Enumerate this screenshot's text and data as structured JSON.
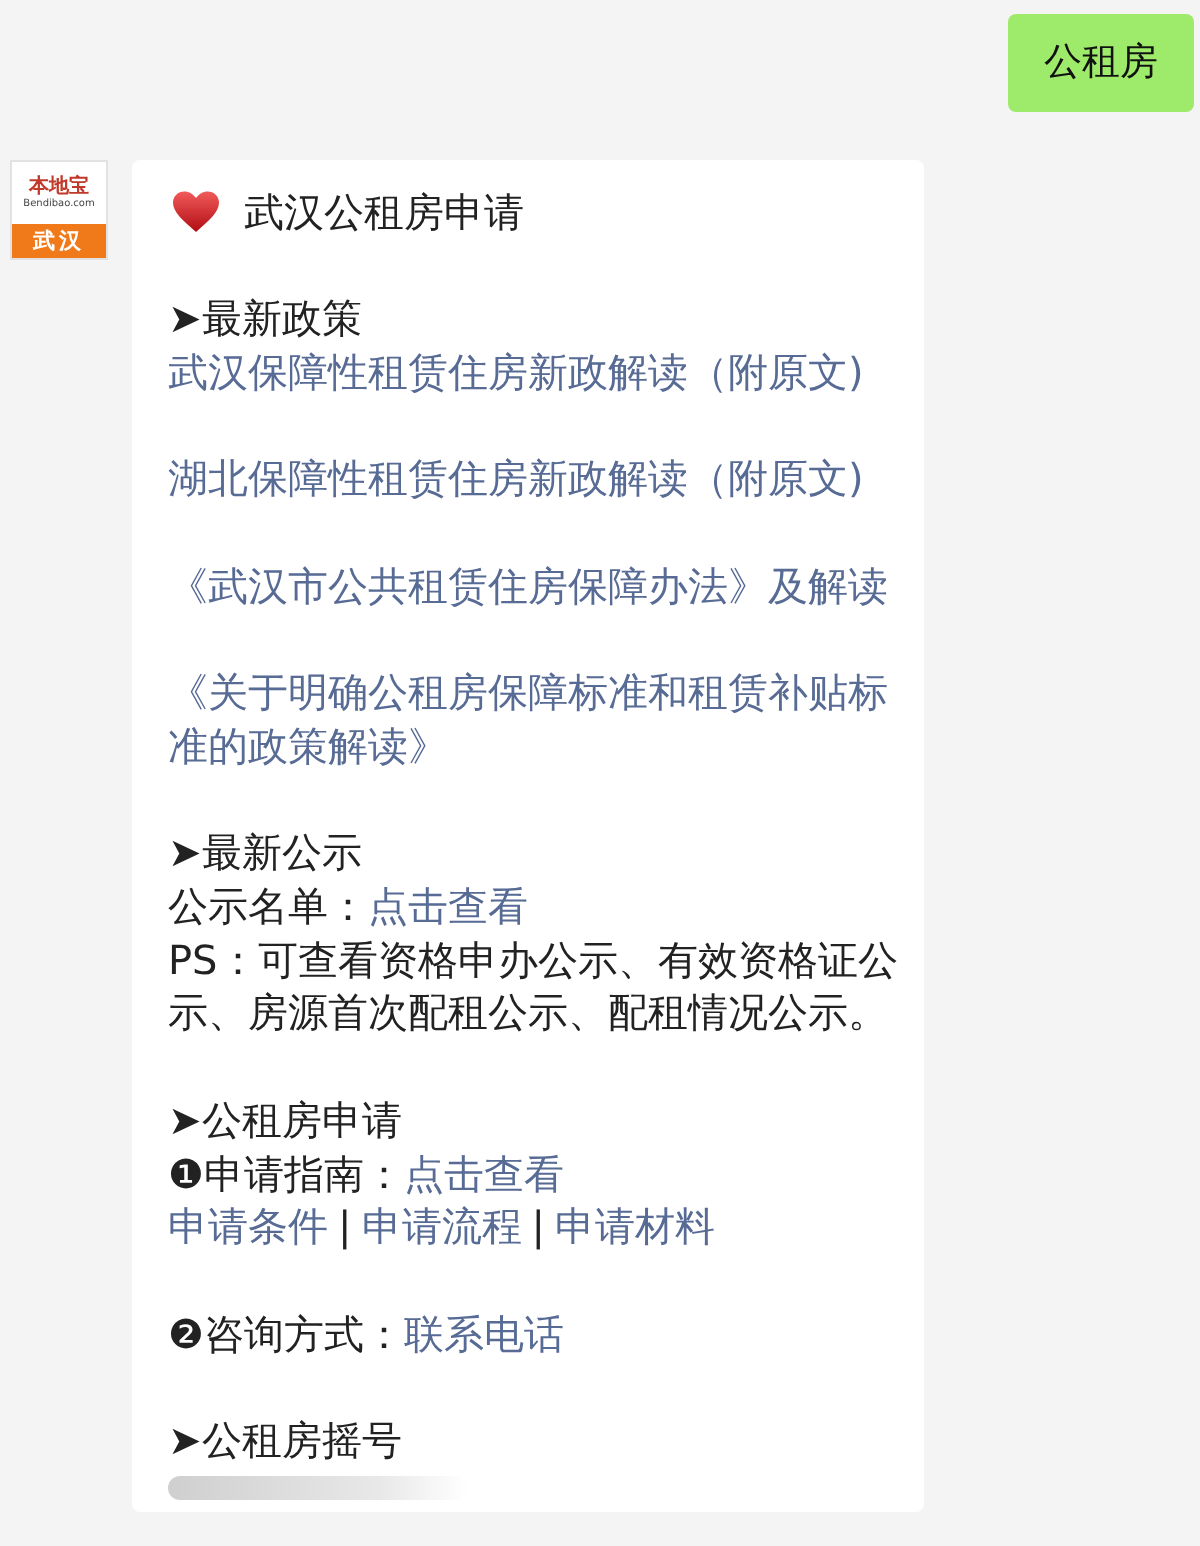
{
  "messages": [
    {
      "kind": "sent",
      "text": "公租房"
    },
    {
      "kind": "received",
      "avatar": {
        "brand": "本地宝",
        "site": "Bendibao.com",
        "city": "武汉"
      },
      "title": "武汉公租房申请",
      "paragraphs": [
        [
          [
            {
              "text": "➤最新政策",
              "link": false
            }
          ],
          [
            {
              "text": "武汉保障性租赁住房新政解读（附原文)",
              "link": true
            }
          ]
        ],
        [
          [
            {
              "text": "湖北保障性租赁住房新政解读（附原文)",
              "link": true
            }
          ]
        ],
        [
          [
            {
              "text": "《武汉市公共租赁住房保障办法》及解读",
              "link": true
            }
          ]
        ],
        [
          [
            {
              "text": "《关于明确公租房保障标准和租赁补贴标准的政策解读》",
              "link": true
            }
          ]
        ],
        [
          [
            {
              "text": "➤最新公示",
              "link": false
            }
          ],
          [
            {
              "text": "公示名单：",
              "link": false
            },
            {
              "text": "点击查看",
              "link": true
            }
          ],
          [
            {
              "text": "PS：可查看资格申办公示、有效资格证公示、房源首次配租公示、配租情况公示。",
              "link": false
            }
          ]
        ],
        [
          [
            {
              "text": "➤公租房申请",
              "link": false
            }
          ],
          [
            {
              "text": "❶申请指南：",
              "link": false
            },
            {
              "text": "点击查看",
              "link": true
            }
          ],
          [
            {
              "text": "申请条件",
              "link": true
            },
            {
              "text": "|",
              "link": false
            },
            {
              "text": "申请流程",
              "link": true
            },
            {
              "text": "|",
              "link": false
            },
            {
              "text": "申请材料",
              "link": true
            }
          ]
        ],
        [
          [
            {
              "text": "❷咨询方式：",
              "link": false
            },
            {
              "text": "联系电话",
              "link": true
            }
          ]
        ],
        [
          [
            {
              "text": "➤公租房摇号",
              "link": false
            }
          ]
        ]
      ]
    }
  ]
}
